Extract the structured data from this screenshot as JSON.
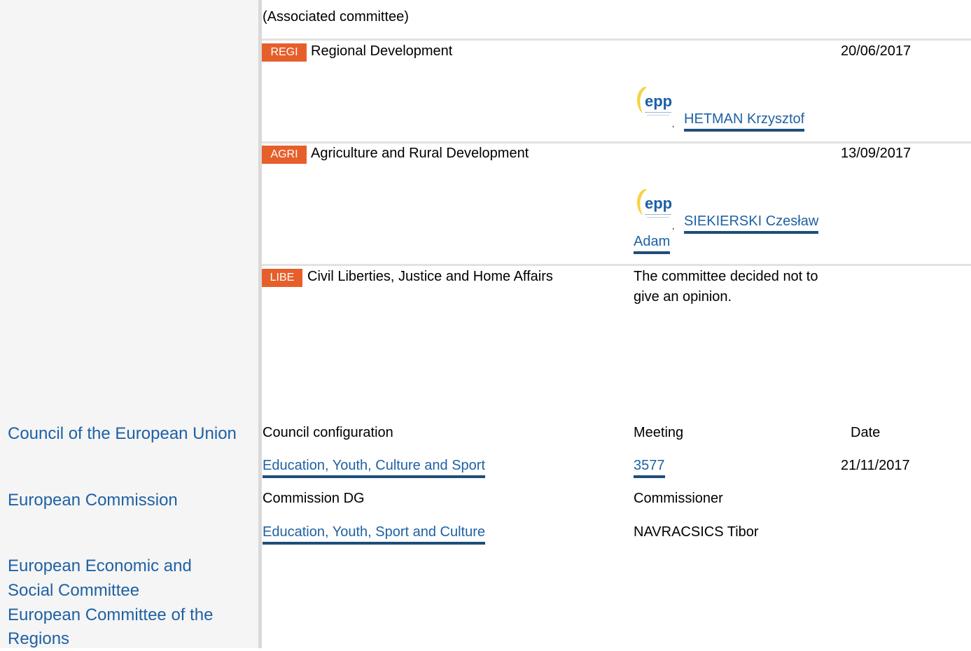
{
  "committee_section": {
    "associated_label": "(Associated committee)",
    "rows": [
      {
        "code": "REGI",
        "name": "Regional Development",
        "rapporteur_first_line": "HETMAN Krzysztof",
        "rapporteur_second_line": "",
        "date": "20/06/2017",
        "group_logo": "epp-logo"
      },
      {
        "code": "AGRI",
        "name": "Agriculture and Rural Development",
        "rapporteur_first_line": "SIEKIERSKI Czesław",
        "rapporteur_second_line": "Adam",
        "date": "13/09/2017",
        "group_logo": "epp-logo"
      },
      {
        "code": "LIBE",
        "name": "Civil Liberties, Justice and Home Affairs",
        "opinion_line1": "The committee decided not to",
        "opinion_line2": "give an opinion."
      }
    ]
  },
  "council": {
    "institution": "Council of the European Union",
    "headers": {
      "configuration": "Council configuration",
      "meeting": "Meeting",
      "date": "Date"
    },
    "configuration": "Education, Youth, Culture and Sport",
    "meeting": "3577",
    "date": "21/11/2017"
  },
  "commission": {
    "institution": "European Commission",
    "headers": {
      "dg": "Commission DG",
      "commissioner": "Commissioner"
    },
    "dg": "Education, Youth, Sport and Culture",
    "commissioner": "NAVRACSICS Tibor"
  },
  "eesc": {
    "line1": "European Economic and",
    "line2": "Social Committee"
  },
  "cor": {
    "line1": "European Committee of the",
    "line2": "Regions"
  },
  "logo_text": "epp",
  "colors": {
    "badge": "#e65f2b",
    "link": "#1f61a3",
    "link_underline": "#1f4e79",
    "epp_blue": "#1b5ea6",
    "epp_yellow": "#f6d244"
  }
}
